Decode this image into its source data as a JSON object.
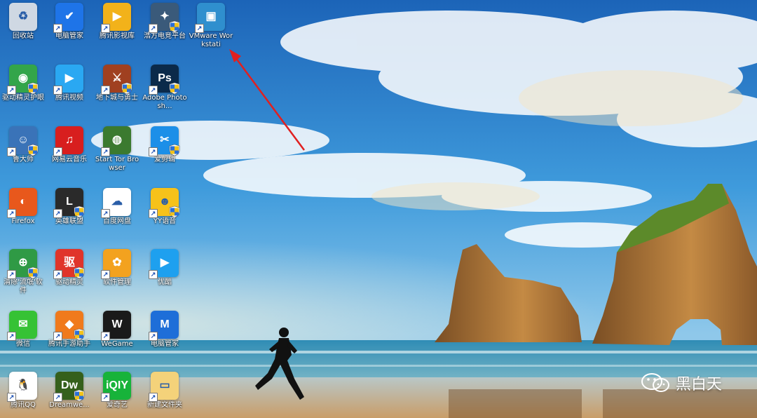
{
  "desktop": {
    "icons": [
      {
        "label": "回收站",
        "icon": "recycle-bin-icon",
        "color": "#cfd8e3",
        "glyph": "♻"
      },
      {
        "label": "电脑管家",
        "icon": "pc-manager-icon",
        "color": "#1e74e8",
        "glyph": "✔"
      },
      {
        "label": "腾讯影视库",
        "icon": "tencent-video-library-icon",
        "color": "#f2b21a",
        "glyph": "▶"
      },
      {
        "label": "浩方电竞平台",
        "icon": "haofang-esports-icon",
        "color": "#3a5a7a",
        "glyph": "✦"
      },
      {
        "label": "VMware Workstati",
        "icon": "vmware-icon",
        "color": "#2f8fce",
        "glyph": "▣"
      },
      {
        "label": "驱动精灵护眼",
        "icon": "eye-care-icon",
        "color": "#33a54a",
        "glyph": "◉"
      },
      {
        "label": "腾讯视频",
        "icon": "tencent-video-icon",
        "color": "#2aa8f2",
        "glyph": "▶"
      },
      {
        "label": "地下城与勇士",
        "icon": "dnf-game-icon",
        "color": "#a04020",
        "glyph": "⚔"
      },
      {
        "label": "Adobe Photosh...",
        "icon": "photoshop-icon",
        "color": "#0b2a4a",
        "glyph": "Ps"
      },
      {
        "label": "鲁大师",
        "icon": "ludashi-icon",
        "color": "#3a73b8",
        "glyph": "☺"
      },
      {
        "label": "网易云音乐",
        "icon": "netease-music-icon",
        "color": "#d81e1e",
        "glyph": "♫"
      },
      {
        "label": "Start Tor Browser",
        "icon": "tor-browser-icon",
        "color": "#3b7a2f",
        "glyph": "◍"
      },
      {
        "label": "爱剪辑",
        "icon": "aijianji-icon",
        "color": "#1c8fe8",
        "glyph": "✂"
      },
      {
        "label": "Firefox",
        "icon": "firefox-icon",
        "color": "#e8581c",
        "glyph": "◐"
      },
      {
        "label": "英雄联盟",
        "icon": "lol-icon",
        "color": "#2a2a2a",
        "glyph": "L"
      },
      {
        "label": "百度网盘",
        "icon": "baidu-netdisk-icon",
        "color": "#ffffff",
        "glyph": "☁"
      },
      {
        "label": "YY语音",
        "icon": "yy-voice-icon",
        "color": "#f6c21a",
        "glyph": "☻"
      },
      {
        "label": "清除'流氓'软件",
        "icon": "cleanup-icon",
        "color": "#2f9a45",
        "glyph": "⊕"
      },
      {
        "label": "驱动精灵",
        "icon": "driver-genius-icon",
        "color": "#e0342a",
        "glyph": "驱"
      },
      {
        "label": "软件管理",
        "icon": "software-manager-icon",
        "color": "#f3a21f",
        "glyph": "✿"
      },
      {
        "label": "优酷",
        "icon": "youku-icon",
        "color": "#1ea0ef",
        "glyph": "▶"
      },
      {
        "label": "微信",
        "icon": "wechat-icon",
        "color": "#36c235",
        "glyph": "✉"
      },
      {
        "label": "腾讯手游助手",
        "icon": "tencent-mobile-game-icon",
        "color": "#f07a1c",
        "glyph": "◆"
      },
      {
        "label": "WeGame",
        "icon": "wegame-icon",
        "color": "#1a1a1a",
        "glyph": "W"
      },
      {
        "label": "电脑管家",
        "icon": "pc-manager-2-icon",
        "color": "#1e6ed8",
        "glyph": "M"
      },
      {
        "label": "腾讯QQ",
        "icon": "qq-icon",
        "color": "#ffffff",
        "glyph": "🐧"
      },
      {
        "label": "Dreamwe...",
        "icon": "dreamweaver-icon",
        "color": "#35601c",
        "glyph": "Dw"
      },
      {
        "label": "爱奇艺",
        "icon": "iqiyi-icon",
        "color": "#17b33a",
        "glyph": "iQIY"
      },
      {
        "label": "新建文件夹",
        "icon": "new-folder-icon",
        "color": "#f4d27a",
        "glyph": "▭"
      }
    ]
  },
  "watermark": {
    "text": "黑白天",
    "icon": "wechat-logo-icon"
  },
  "colors": {
    "sky_top": "#1e6fc2",
    "sky_mid": "#4aa5de",
    "sea": "#2e8fb3",
    "sand": "#c9a06a",
    "rock": "#b07a3c",
    "grass": "#5c8a2a"
  }
}
